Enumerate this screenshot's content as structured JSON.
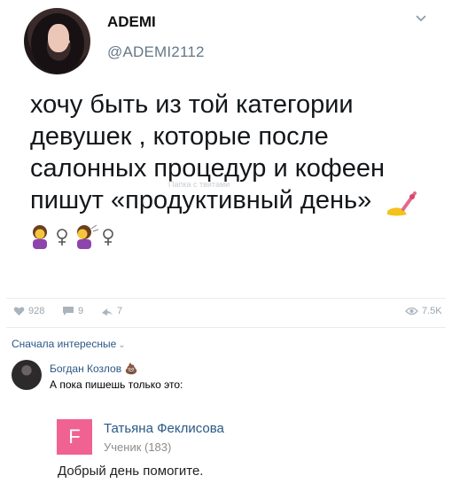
{
  "tweet": {
    "author_name": "ADEMI",
    "author_handle": "@ADEMI2112",
    "text": "хочу быть из той категории девушек , которые после салонных процедур и кофеен пишут «продуктивный день»",
    "emoji_tail": "💅",
    "emoji_line": "💆‍♀️💇‍♀️",
    "watermark": "Папка с твитами",
    "menu_icon": "chevron-down-icon"
  },
  "stats": {
    "likes": "928",
    "comments": "9",
    "reposts": "7",
    "views": "7.5K"
  },
  "comments_sort": {
    "label": "Сначала интересные"
  },
  "comment": {
    "author": "Богдан Козлов",
    "author_emoji": "💩",
    "text": "А пока пишешь только это:"
  },
  "answer_card": {
    "avatar_letter": "F",
    "author": "Татьяна Феклисова",
    "rank": "Ученик (183)",
    "body": "Добрый день помогите.",
    "accent_color": "#f06292"
  }
}
